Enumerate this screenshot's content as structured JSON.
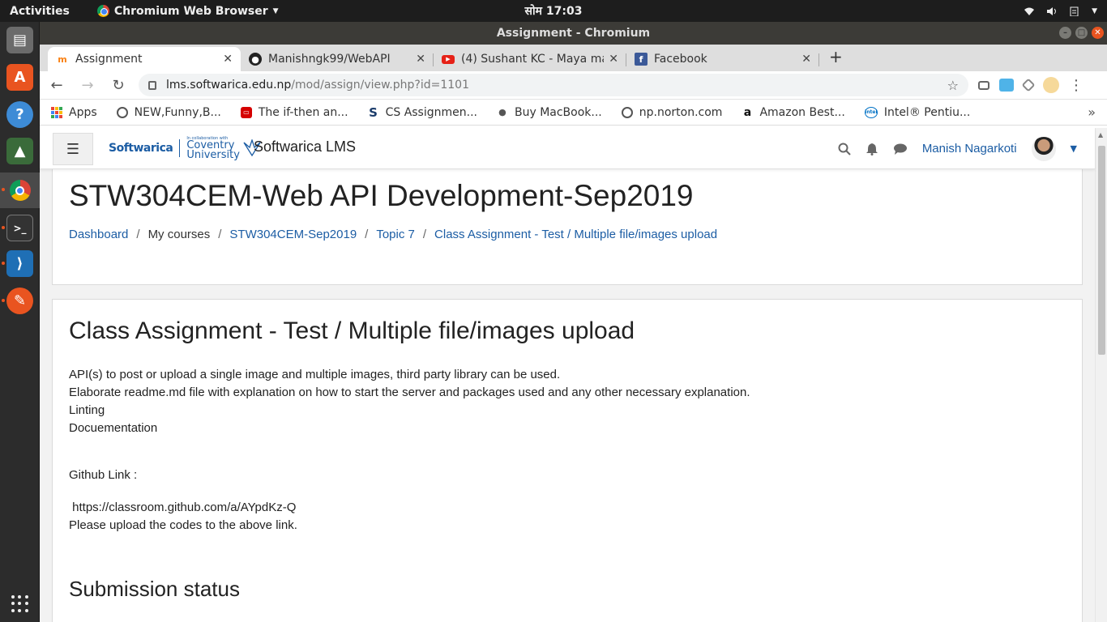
{
  "os": {
    "activities": "Activities",
    "app_menu": "Chromium Web Browser",
    "clock": "सोम 17:03"
  },
  "window": {
    "title": "Assignment - Chromium"
  },
  "tabs": [
    {
      "title": "Assignment",
      "favicon": "moodle-icon"
    },
    {
      "title": "Manishngk99/WebAPI",
      "favicon": "github-icon"
    },
    {
      "title": "(4) Sushant KC - Maya ma (",
      "favicon": "youtube-icon"
    },
    {
      "title": "Facebook",
      "favicon": "facebook-icon"
    }
  ],
  "address": {
    "host": "lms.softwarica.edu.np",
    "path": "/mod/assign/view.php?id=1101"
  },
  "bookmarks": [
    {
      "label": "Apps",
      "icon": "apps-grid-icon"
    },
    {
      "label": "NEW,Funny,B...",
      "icon": "globe-icon"
    },
    {
      "label": "The if-then an...",
      "icon": "red-square-icon"
    },
    {
      "label": "CS Assignmen...",
      "icon": "s-logo-icon"
    },
    {
      "label": "Buy MacBook...",
      "icon": "apple-icon"
    },
    {
      "label": "np.norton.com",
      "icon": "globe-icon"
    },
    {
      "label": "Amazon Best...",
      "icon": "amazon-icon"
    },
    {
      "label": "Intel® Pentiu...",
      "icon": "intel-icon"
    }
  ],
  "site": {
    "logo_left": "Softwarica",
    "logo_collab": "In collaboration with",
    "logo_right_1": "Coventry",
    "logo_right_2": "University",
    "name": "Softwarica LMS",
    "user": "Manish Nagarkoti"
  },
  "course": {
    "title": "STW304CEM-Web API Development-Sep2019",
    "breadcrumb": [
      "Dashboard",
      "My courses",
      "STW304CEM-Sep2019",
      "Topic 7",
      "Class Assignment - Test / Multiple file/images upload"
    ]
  },
  "assignment": {
    "title": "Class Assignment - Test / Multiple file/images upload",
    "lines": [
      "API(s) to post or upload a single image and multiple images, third party library can be used.",
      "Elaborate readme.md file with explanation on how to start the server and packages used and any other necessary explanation.",
      "Linting",
      "Docuementation"
    ],
    "github_label": "Github Link :",
    "github_url": " https://classroom.github.com/a/AYpdKz-Q",
    "upload_note": "Please upload the codes to the above link.",
    "submission_heading": "Submission status"
  },
  "colors": {
    "link": "#1c5da4",
    "ubuntu_orange": "#e95420"
  }
}
